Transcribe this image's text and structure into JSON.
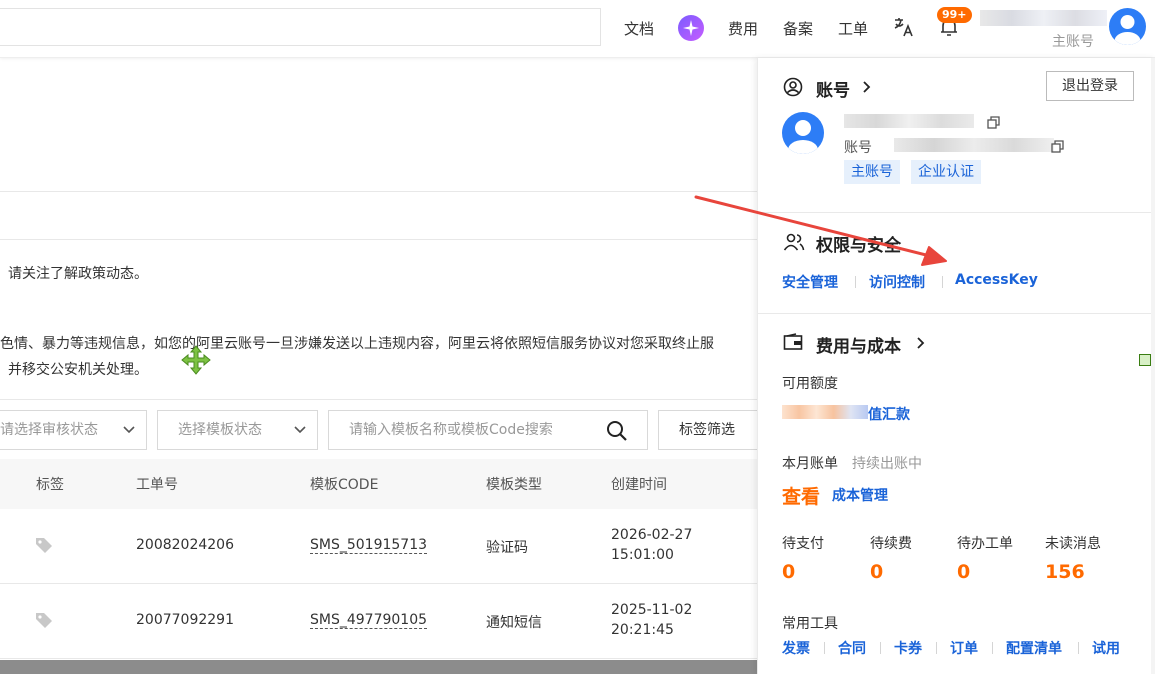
{
  "topbar": {
    "nav": [
      "文档",
      "费用",
      "备案",
      "工单"
    ],
    "badge": "99+",
    "account_label": "主账号",
    "icons": [
      "ai-assistant-icon",
      "translate-icon",
      "bell-icon"
    ]
  },
  "notice": {
    "line1": "请关注了解政策动态。",
    "line2": "色情、暴力等违规信息，如您的阿里云账号一旦涉嫌发送以上违规内容，阿里云将依照短信服务协议对您采取终止服",
    "line3": "并移交公安机关处理。"
  },
  "filters": {
    "review_status_placeholder": "请选择审核状态",
    "template_status_placeholder": "选择模板状态",
    "search_placeholder": "请输入模板名称或模板Code搜索",
    "tag_filter_label": "标签筛选"
  },
  "table": {
    "columns": [
      "标签",
      "工单号",
      "模板CODE",
      "模板类型",
      "创建时间"
    ],
    "rows": [
      {
        "ticket": "20082024206",
        "code": "SMS_501915713",
        "type": "验证码",
        "date": "2026-02-27",
        "time": "15:01:00"
      },
      {
        "ticket": "20077092291",
        "code": "SMS_497790105",
        "type": "通知短信",
        "date": "2025-11-02",
        "time": "20:21:45"
      }
    ]
  },
  "panel": {
    "account": {
      "title": "账号",
      "logout_label": "退出登录",
      "account_prefix": "账号",
      "tags": [
        "主账号",
        "企业认证"
      ]
    },
    "security": {
      "title": "权限与安全",
      "links": [
        "安全管理",
        "访问控制",
        "AccessKey"
      ]
    },
    "billing": {
      "title": "费用与成本",
      "available_label": "可用额度",
      "recharge_link": "值汇款",
      "monthly_label": "本月账单",
      "monthly_status": "持续出账中",
      "view_label": "查看",
      "cost_mgmt_link": "成本管理",
      "stats": [
        {
          "label": "待支付",
          "value": "0"
        },
        {
          "label": "待续费",
          "value": "0"
        },
        {
          "label": "待办工单",
          "value": "0"
        },
        {
          "label": "未读消息",
          "value": "156"
        }
      ],
      "tools_label": "常用工具",
      "tools": [
        "发票",
        "合同",
        "卡券",
        "订单",
        "配置清单",
        "试用"
      ]
    }
  },
  "colors": {
    "accent_blue": "#1a63d8",
    "accent_orange": "#ff6a00",
    "annotation_red": "#e8453c"
  }
}
